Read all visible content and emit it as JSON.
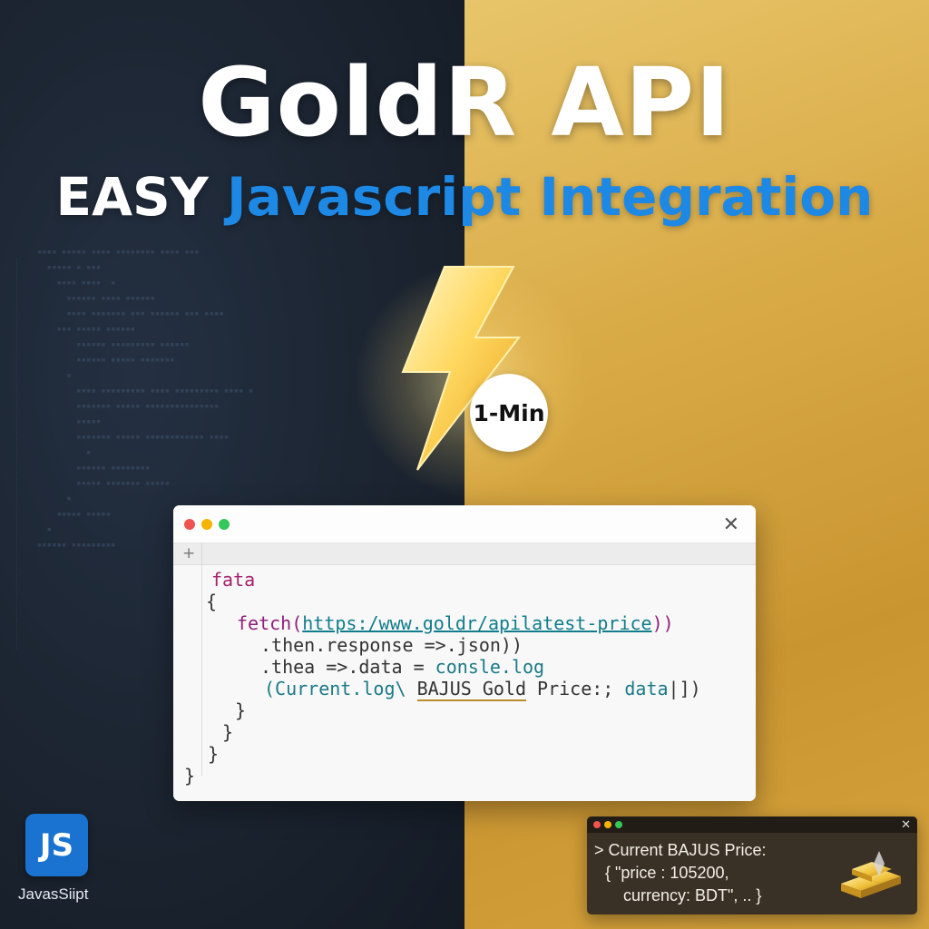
{
  "header": {
    "title": "GoldR API",
    "subtitle_strong": "EASY",
    "subtitle_rest": "Javascript Integration"
  },
  "badge": {
    "label": "1-Min"
  },
  "code_window": {
    "tab_add": "+",
    "close_glyph": "✕",
    "lines": {
      "l1": "fata",
      "l2": "{",
      "l3_fn": "fetch(",
      "l3_url": "https:/www.goldr/apilatest-price",
      "l3_end": "))",
      "l4": ".then.response =>.json))",
      "l5_a": ".thea =>.data = ",
      "l5_b": "consle.log",
      "l6_a": "(Current.log\\ ",
      "l6_b": "BAJUS Gold",
      "l6_c": " Price:; ",
      "l6_d": "data",
      "l6_e": "|])",
      "l7": "}",
      "l8": "}",
      "l9": "}",
      "l10": "}"
    }
  },
  "console": {
    "close_glyph": "✕",
    "line1": "> Current BAJUS Price:",
    "line2": "{ \"price : 105200,",
    "line3": "currency: BDT\", .. }"
  },
  "logo": {
    "mark": "JS",
    "label": "JavasSiipt"
  },
  "colors": {
    "accent_blue": "#1e88e5",
    "gold": "#d9ab47",
    "dark_navy": "#1b2430"
  },
  "icons": {
    "bolt": "lightning-bolt-icon",
    "gold": "gold-bars-icon"
  }
}
